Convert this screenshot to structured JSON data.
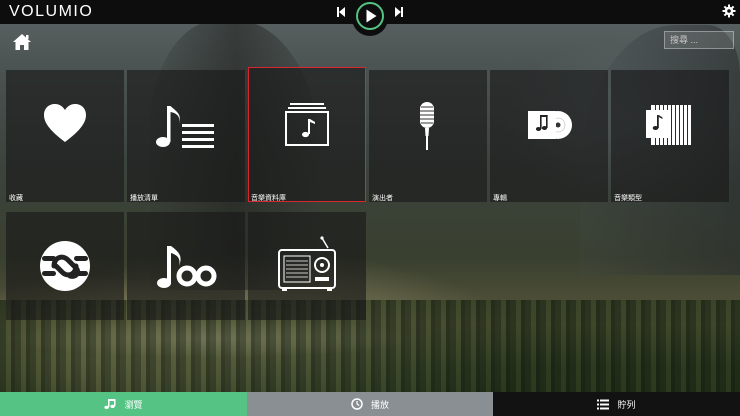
{
  "app": {
    "logo": "VOLUMIO"
  },
  "search": {
    "placeholder": "搜尋 ..."
  },
  "tiles": [
    {
      "label": "收藏",
      "icon": "heart-icon"
    },
    {
      "label": "播放清單",
      "icon": "playlist-icon"
    },
    {
      "label": "音樂資料庫",
      "icon": "music-library-icon"
    },
    {
      "label": "演出者",
      "icon": "microphone-icon"
    },
    {
      "label": "專輯",
      "icon": "album-icon"
    },
    {
      "label": "音樂類型",
      "icon": "genres-icon"
    },
    {
      "label": "",
      "icon": "streaming-service-icon"
    },
    {
      "label": "",
      "icon": "music-service-icon"
    },
    {
      "label": "",
      "icon": "web-radio-icon"
    }
  ],
  "tabs": {
    "browse": "瀏覽",
    "playback": "播放",
    "queue": "貯列"
  },
  "colors": {
    "accent": "#54c383",
    "selected_outline": "#d9252d",
    "playback_tab": "#8a8f94",
    "queue_tab": "#121212"
  }
}
